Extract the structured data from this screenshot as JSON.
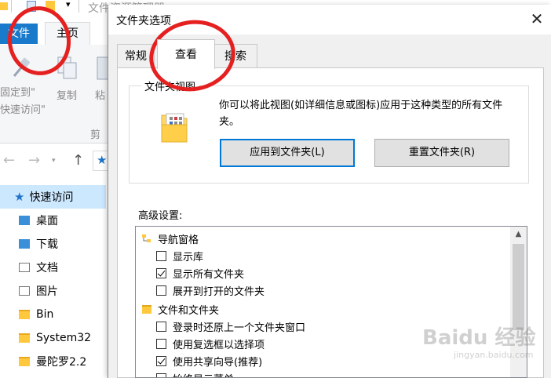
{
  "explorer": {
    "title_partial": "文件资源管理器",
    "tabs": {
      "file": "文件",
      "home": "主页"
    },
    "ribbon": {
      "pin_label_line1": "固定到\"",
      "pin_label_line2": "快速访问\"",
      "copy_label": "复制",
      "paste_label_partial": "粘",
      "group_label_partial": "剪"
    },
    "nav": {
      "back": "←",
      "forward": "→",
      "up": "↑"
    },
    "sidebar": [
      {
        "label": "快速访问",
        "icon": "star-icon"
      },
      {
        "label": "桌面",
        "icon": "folder-icon"
      },
      {
        "label": "下载",
        "icon": "download-folder-icon"
      },
      {
        "label": "文档",
        "icon": "document-folder-icon"
      },
      {
        "label": "图片",
        "icon": "pictures-folder-icon"
      },
      {
        "label": "Bin",
        "icon": "folder-icon"
      },
      {
        "label": "System32",
        "icon": "folder-icon"
      },
      {
        "label": "曼陀罗2.2",
        "icon": "folder-icon"
      }
    ]
  },
  "dialog": {
    "title": "文件夹选项",
    "close": "✕",
    "tabs": [
      {
        "label": "常规",
        "selected": false
      },
      {
        "label": "查看",
        "selected": true
      },
      {
        "label": "搜索",
        "selected": false
      }
    ],
    "folder_views": {
      "legend": "文件夹视图",
      "description": "你可以将此视图(如详细信息或图标)应用于这种类型的所有文件夹。",
      "apply_button": "应用到文件夹(L)",
      "reset_button": "重置文件夹(R)"
    },
    "advanced": {
      "label": "高级设置:",
      "items": [
        {
          "type": "group",
          "label": "导航窗格",
          "icon": "navigation-pane-icon"
        },
        {
          "type": "checkbox",
          "label": "显示库",
          "checked": false
        },
        {
          "type": "checkbox",
          "label": "显示所有文件夹",
          "checked": true
        },
        {
          "type": "checkbox",
          "label": "展开到打开的文件夹",
          "checked": false
        },
        {
          "type": "group",
          "label": "文件和文件夹",
          "icon": "folder-icon"
        },
        {
          "type": "checkbox",
          "label": "登录时还原上一个文件夹窗口",
          "checked": false
        },
        {
          "type": "checkbox",
          "label": "使用复选框以选择项",
          "checked": false
        },
        {
          "type": "checkbox",
          "label": "使用共享向导(推荐)",
          "checked": true
        },
        {
          "type": "checkbox",
          "label": "始终显示菜单",
          "checked": false
        }
      ]
    }
  },
  "watermark": {
    "text": "Baidu 经验",
    "sub": "jingyan.baidu.com"
  },
  "colors": {
    "accent": "#1979ca",
    "annotation": "#e52020",
    "selection": "#cce8ff"
  }
}
